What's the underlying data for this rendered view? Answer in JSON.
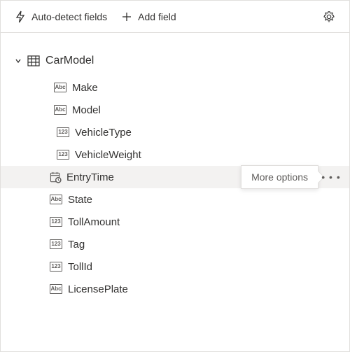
{
  "toolbar": {
    "auto_detect_label": "Auto-detect fields",
    "add_field_label": "Add field"
  },
  "table": {
    "name": "CarModel",
    "fields": [
      {
        "name": "Make",
        "type": "Abc",
        "indent": 1
      },
      {
        "name": "Model",
        "type": "Abc",
        "indent": 1
      },
      {
        "name": "VehicleType",
        "type": "123",
        "indent": 2
      },
      {
        "name": "VehicleWeight",
        "type": "123",
        "indent": 2
      },
      {
        "name": "EntryTime",
        "type": "date",
        "indent": 0,
        "hovered": true
      },
      {
        "name": "State",
        "type": "Abc",
        "indent": 0
      },
      {
        "name": "TollAmount",
        "type": "123",
        "indent": 0
      },
      {
        "name": "Tag",
        "type": "123",
        "indent": 0
      },
      {
        "name": "TollId",
        "type": "123",
        "indent": 0
      },
      {
        "name": "LicensePlate",
        "type": "Abc",
        "indent": 0
      }
    ]
  },
  "tooltip": {
    "more_options": "More options"
  }
}
